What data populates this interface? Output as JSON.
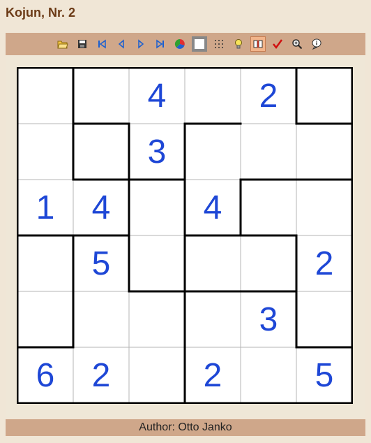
{
  "title": "Kojun, Nr. 2",
  "footer": "Author: Otto Janko",
  "toolbar": [
    {
      "name": "open-folder-icon"
    },
    {
      "name": "save-icon"
    },
    {
      "name": "first-icon"
    },
    {
      "name": "previous-icon"
    },
    {
      "name": "next-icon"
    },
    {
      "name": "last-icon"
    },
    {
      "name": "color-wheel-icon"
    },
    {
      "name": "white-square-icon"
    },
    {
      "name": "grid-dots-icon"
    },
    {
      "name": "lightbulb-icon"
    },
    {
      "name": "book-icon",
      "active": true
    },
    {
      "name": "checkmark-icon"
    },
    {
      "name": "zoom-in-icon"
    },
    {
      "name": "info-icon"
    }
  ],
  "grid": [
    [
      "",
      "",
      "4",
      "",
      "2",
      ""
    ],
    [
      "",
      "",
      "3",
      "",
      "",
      ""
    ],
    [
      "1",
      "4",
      "",
      "4",
      "",
      ""
    ],
    [
      "",
      "5",
      "",
      "",
      "",
      "2"
    ],
    [
      "",
      "",
      "",
      "",
      "3",
      ""
    ],
    [
      "6",
      "2",
      "",
      "2",
      "",
      "5"
    ]
  ],
  "colors": {
    "digit": "#1e47d6",
    "title": "#6b3a16",
    "bar": "#cfa78a"
  }
}
